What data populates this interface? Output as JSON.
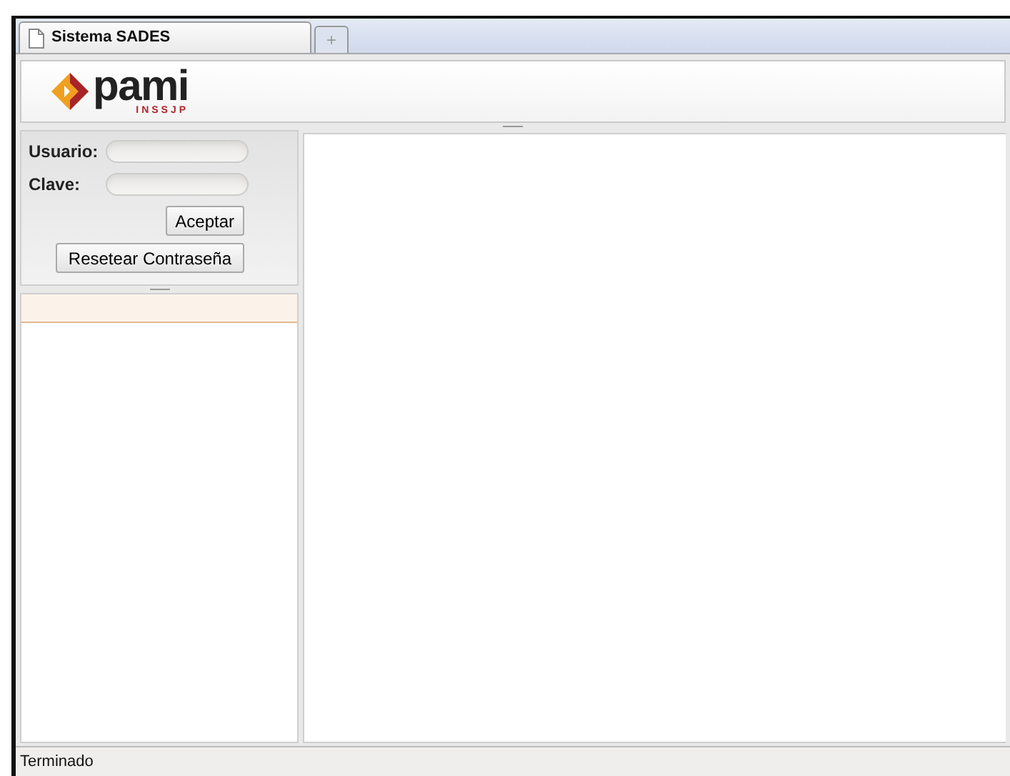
{
  "tabs": [
    {
      "title": "Sistema SADES",
      "selected": true
    }
  ],
  "new_tab": "+",
  "logo": {
    "name": "pami",
    "subtitle": "INSSJP"
  },
  "login": {
    "fields": [
      {
        "label": "Usuario:"
      },
      {
        "label": "Clave:"
      }
    ],
    "submit": "Aceptar",
    "reset": "Resetear Contraseña"
  },
  "status_bar": "Terminado"
}
